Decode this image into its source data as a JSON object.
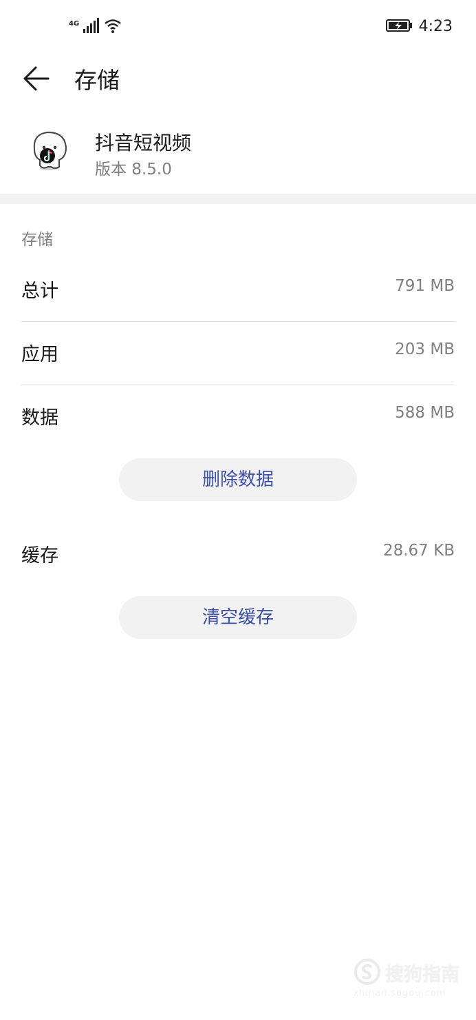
{
  "status_bar": {
    "network": "4G",
    "time": "4:23"
  },
  "header": {
    "title": "存储"
  },
  "app": {
    "name": "抖音短视频",
    "version": "版本 8.5.0"
  },
  "storage": {
    "section_label": "存储",
    "total": {
      "label": "总计",
      "value": "791 MB"
    },
    "app": {
      "label": "应用",
      "value": "203 MB"
    },
    "data": {
      "label": "数据",
      "value": "588 MB"
    },
    "delete_data_button": "删除数据",
    "cache": {
      "label": "缓存",
      "value": "28.67 KB"
    },
    "clear_cache_button": "清空缓存"
  },
  "watermark": {
    "text": "搜狗指南",
    "url": "zhinan.sogou.com"
  },
  "colors": {
    "accent": "#3c4fa8",
    "secondary_text": "#808080",
    "button_bg": "#f2f2f2"
  }
}
